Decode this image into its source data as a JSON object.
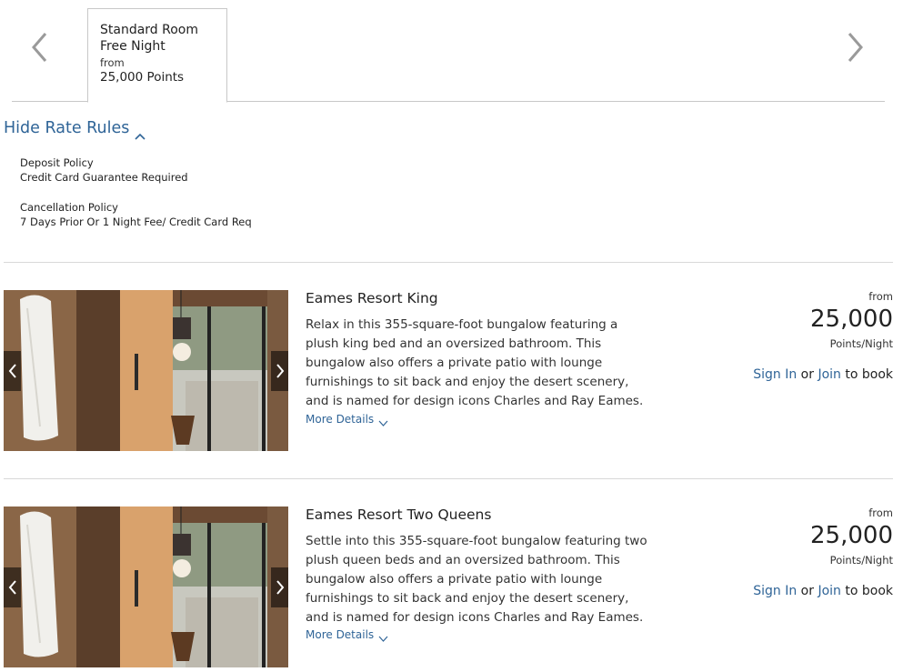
{
  "rate_tabs": {
    "items": [
      {
        "line1": "Standard Room",
        "line2": "Free Night",
        "line3": "from",
        "line4": "25,000 Points"
      }
    ],
    "prev_icon": "chevron-left-icon",
    "next_icon": "chevron-right-icon"
  },
  "rate_rules": {
    "toggle_label": "Hide Rate Rules",
    "toggle_icon": "chevron-up-icon",
    "deposit_title": "Deposit Policy",
    "deposit_value": "Credit Card Guarantee Required",
    "cancel_title": "Cancellation Policy",
    "cancel_value": "7 Days Prior Or 1 Night Fee/ Credit Card Req"
  },
  "rooms": [
    {
      "name": "Eames Resort King",
      "description": "Relax in this 355-square-foot bungalow featuring a plush king bed and an oversized bathroom. This bungalow also offers a private patio with lounge furnishings to sit back and enjoy the desert scenery, and is named for design icons Charles and Ray Eames.",
      "more_details": "More Details",
      "price_from": "from",
      "price": "25,000",
      "price_unit": "Points/Night",
      "sign_in": "Sign In",
      "or": "or",
      "join": "Join",
      "to_book": "to book"
    },
    {
      "name": "Eames Resort Two Queens",
      "description": "Settle into this 355-square-foot bungalow featuring two plush queen beds and an oversized bathroom. This bungalow also offers a private patio with lounge furnishings to sit back and enjoy the desert scenery, and is named for design icons Charles and Ray Eames.",
      "more_details": "More Details",
      "price_from": "from",
      "price": "25,000",
      "price_unit": "Points/Night",
      "sign_in": "Sign In",
      "or": "or",
      "join": "Join",
      "to_book": "to book"
    }
  ],
  "colors": {
    "link": "#2f6497",
    "text": "#222222",
    "border": "#c8c8c8"
  }
}
